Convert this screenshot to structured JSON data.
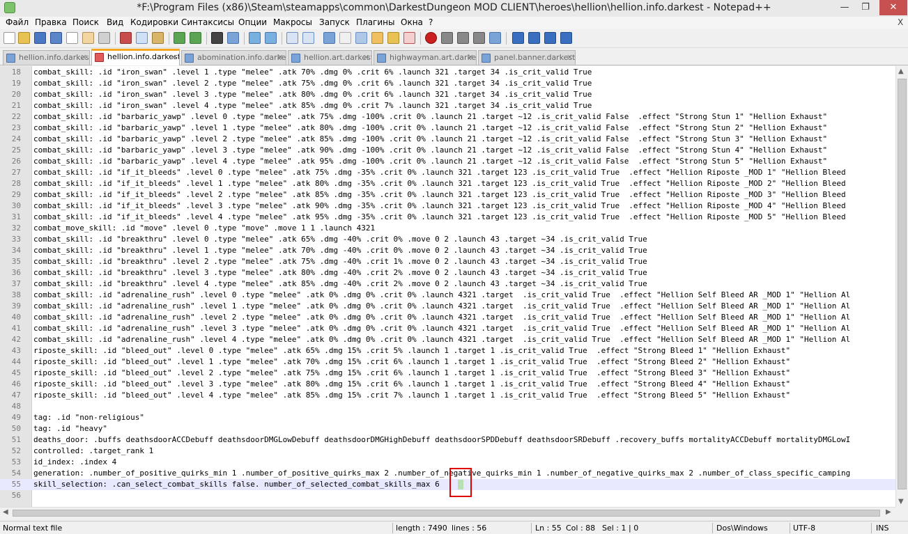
{
  "window": {
    "title": "*F:\\Program Files (x86)\\Steam\\steamapps\\common\\DarkestDungeon MOD CLIENT\\heroes\\hellion\\hellion.info.darkest - Notepad++",
    "minimize": "—",
    "maximize": "❐",
    "close": "✕"
  },
  "menu": {
    "items": [
      "Файл",
      "Правка",
      "Поиск",
      "Вид",
      "Кодировки",
      "Синтаксисы",
      "Опции",
      "Макросы",
      "Запуск",
      "Плагины",
      "Окна",
      "?"
    ],
    "close": "X"
  },
  "tabs": [
    {
      "label": "hellion.info.darkest",
      "active": false
    },
    {
      "label": "hellion.info.darkest",
      "active": true
    },
    {
      "label": "abomination.info.darkest",
      "active": false
    },
    {
      "label": "hellion.art.darkest",
      "active": false
    },
    {
      "label": "highwayman.art.darkest",
      "active": false
    },
    {
      "label": "panel.banner.darkest",
      "active": false
    }
  ],
  "editor": {
    "current_line": 55,
    "lines": [
      {
        "n": "18",
        "text": "combat_skill: .id \"iron_swan\" .level 1 .type \"melee\" .atk 70% .dmg 0% .crit 6% .launch 321 .target 34 .is_crit_valid True"
      },
      {
        "n": "19",
        "text": "combat_skill: .id \"iron_swan\" .level 2 .type \"melee\" .atk 75% .dmg 0% .crit 6% .launch 321 .target 34 .is_crit_valid True"
      },
      {
        "n": "20",
        "text": "combat_skill: .id \"iron_swan\" .level 3 .type \"melee\" .atk 80% .dmg 0% .crit 6% .launch 321 .target 34 .is_crit_valid True"
      },
      {
        "n": "21",
        "text": "combat_skill: .id \"iron_swan\" .level 4 .type \"melee\" .atk 85% .dmg 0% .crit 7% .launch 321 .target 34 .is_crit_valid True"
      },
      {
        "n": "22",
        "text": "combat_skill: .id \"barbaric_yawp\" .level 0 .type \"melee\" .atk 75% .dmg -100% .crit 0% .launch 21 .target ~12 .is_crit_valid False  .effect \"Strong Stun 1\" \"Hellion Exhaust\""
      },
      {
        "n": "23",
        "text": "combat_skill: .id \"barbaric_yawp\" .level 1 .type \"melee\" .atk 80% .dmg -100% .crit 0% .launch 21 .target ~12 .is_crit_valid False  .effect \"Strong Stun 2\" \"Hellion Exhaust\""
      },
      {
        "n": "24",
        "text": "combat_skill: .id \"barbaric_yawp\" .level 2 .type \"melee\" .atk 85% .dmg -100% .crit 0% .launch 21 .target ~12 .is_crit_valid False  .effect \"Strong Stun 3\" \"Hellion Exhaust\""
      },
      {
        "n": "25",
        "text": "combat_skill: .id \"barbaric_yawp\" .level 3 .type \"melee\" .atk 90% .dmg -100% .crit 0% .launch 21 .target ~12 .is_crit_valid False  .effect \"Strong Stun 4\" \"Hellion Exhaust\""
      },
      {
        "n": "26",
        "text": "combat_skill: .id \"barbaric_yawp\" .level 4 .type \"melee\" .atk 95% .dmg -100% .crit 0% .launch 21 .target ~12 .is_crit_valid False  .effect \"Strong Stun 5\" \"Hellion Exhaust\""
      },
      {
        "n": "27",
        "text": "combat_skill: .id \"if_it_bleeds\" .level 0 .type \"melee\" .atk 75% .dmg -35% .crit 0% .launch 321 .target 123 .is_crit_valid True  .effect \"Hellion Riposte _MOD 1\" \"Hellion Bleed"
      },
      {
        "n": "28",
        "text": "combat_skill: .id \"if_it_bleeds\" .level 1 .type \"melee\" .atk 80% .dmg -35% .crit 0% .launch 321 .target 123 .is_crit_valid True  .effect \"Hellion Riposte _MOD 2\" \"Hellion Bleed"
      },
      {
        "n": "29",
        "text": "combat_skill: .id \"if_it_bleeds\" .level 2 .type \"melee\" .atk 85% .dmg -35% .crit 0% .launch 321 .target 123 .is_crit_valid True  .effect \"Hellion Riposte _MOD 3\" \"Hellion Bleed"
      },
      {
        "n": "30",
        "text": "combat_skill: .id \"if_it_bleeds\" .level 3 .type \"melee\" .atk 90% .dmg -35% .crit 0% .launch 321 .target 123 .is_crit_valid True  .effect \"Hellion Riposte _MOD 4\" \"Hellion Bleed"
      },
      {
        "n": "31",
        "text": "combat_skill: .id \"if_it_bleeds\" .level 4 .type \"melee\" .atk 95% .dmg -35% .crit 0% .launch 321 .target 123 .is_crit_valid True  .effect \"Hellion Riposte _MOD 5\" \"Hellion Bleed"
      },
      {
        "n": "32",
        "text": "combat_move_skill: .id \"move\" .level 0 .type \"move\" .move 1 1 .launch 4321"
      },
      {
        "n": "33",
        "text": "combat_skill: .id \"breakthru\" .level 0 .type \"melee\" .atk 65% .dmg -40% .crit 0% .move 0 2 .launch 43 .target ~34 .is_crit_valid True"
      },
      {
        "n": "34",
        "text": "combat_skill: .id \"breakthru\" .level 1 .type \"melee\" .atk 70% .dmg -40% .crit 0% .move 0 2 .launch 43 .target ~34 .is_crit_valid True"
      },
      {
        "n": "35",
        "text": "combat_skill: .id \"breakthru\" .level 2 .type \"melee\" .atk 75% .dmg -40% .crit 1% .move 0 2 .launch 43 .target ~34 .is_crit_valid True"
      },
      {
        "n": "36",
        "text": "combat_skill: .id \"breakthru\" .level 3 .type \"melee\" .atk 80% .dmg -40% .crit 2% .move 0 2 .launch 43 .target ~34 .is_crit_valid True"
      },
      {
        "n": "37",
        "text": "combat_skill: .id \"breakthru\" .level 4 .type \"melee\" .atk 85% .dmg -40% .crit 2% .move 0 2 .launch 43 .target ~34 .is_crit_valid True"
      },
      {
        "n": "38",
        "text": "combat_skill: .id \"adrenaline_rush\" .level 0 .type \"melee\" .atk 0% .dmg 0% .crit 0% .launch 4321 .target  .is_crit_valid True  .effect \"Hellion Self Bleed AR _MOD 1\" \"Hellion Al"
      },
      {
        "n": "39",
        "text": "combat_skill: .id \"adrenaline_rush\" .level 1 .type \"melee\" .atk 0% .dmg 0% .crit 0% .launch 4321 .target  .is_crit_valid True  .effect \"Hellion Self Bleed AR _MOD 1\" \"Hellion Al"
      },
      {
        "n": "40",
        "text": "combat_skill: .id \"adrenaline_rush\" .level 2 .type \"melee\" .atk 0% .dmg 0% .crit 0% .launch 4321 .target  .is_crit_valid True  .effect \"Hellion Self Bleed AR _MOD 1\" \"Hellion Al"
      },
      {
        "n": "41",
        "text": "combat_skill: .id \"adrenaline_rush\" .level 3 .type \"melee\" .atk 0% .dmg 0% .crit 0% .launch 4321 .target  .is_crit_valid True  .effect \"Hellion Self Bleed AR _MOD 1\" \"Hellion Al"
      },
      {
        "n": "42",
        "text": "combat_skill: .id \"adrenaline_rush\" .level 4 .type \"melee\" .atk 0% .dmg 0% .crit 0% .launch 4321 .target  .is_crit_valid True  .effect \"Hellion Self Bleed AR _MOD 1\" \"Hellion Al"
      },
      {
        "n": "43",
        "text": "riposte_skill: .id \"bleed_out\" .level 0 .type \"melee\" .atk 65% .dmg 15% .crit 5% .launch 1 .target 1 .is_crit_valid True  .effect \"Strong Bleed 1\" \"Hellion Exhaust\""
      },
      {
        "n": "44",
        "text": "riposte_skill: .id \"bleed_out\" .level 1 .type \"melee\" .atk 70% .dmg 15% .crit 6% .launch 1 .target 1 .is_crit_valid True  .effect \"Strong Bleed 2\" \"Hellion Exhaust\""
      },
      {
        "n": "45",
        "text": "riposte_skill: .id \"bleed_out\" .level 2 .type \"melee\" .atk 75% .dmg 15% .crit 6% .launch 1 .target 1 .is_crit_valid True  .effect \"Strong Bleed 3\" \"Hellion Exhaust\""
      },
      {
        "n": "46",
        "text": "riposte_skill: .id \"bleed_out\" .level 3 .type \"melee\" .atk 80% .dmg 15% .crit 6% .launch 1 .target 1 .is_crit_valid True  .effect \"Strong Bleed 4\" \"Hellion Exhaust\""
      },
      {
        "n": "47",
        "text": "riposte_skill: .id \"bleed_out\" .level 4 .type \"melee\" .atk 85% .dmg 15% .crit 7% .launch 1 .target 1 .is_crit_valid True  .effect \"Strong Bleed 5\" \"Hellion Exhaust\""
      },
      {
        "n": "48",
        "text": ""
      },
      {
        "n": "49",
        "text": "tag: .id \"non-religious\""
      },
      {
        "n": "50",
        "text": "tag: .id \"heavy\""
      },
      {
        "n": "51",
        "text": "deaths_door: .buffs deathsdoorACCDebuff deathsdoorDMGLowDebuff deathsdoorDMGHighDebuff deathsdoorSPDDebuff deathsdoorSRDebuff .recovery_buffs mortalityACCDebuff mortalityDMGLowI"
      },
      {
        "n": "52",
        "text": "controlled: .target_rank 1"
      },
      {
        "n": "53",
        "text": "id_index: .index 4"
      },
      {
        "n": "54",
        "text": "generation: .number_of_positive_quirks_min 1 .number_of_positive_quirks_max 2 .number_of_negative_quirks_min 1 .number_of_negative_quirks_max 2 .number_of_class_specific_camping"
      },
      {
        "n": "55",
        "text": "skill_selection: .can_select_combat_skills false. number_of_selected_combat_skills_max 6"
      },
      {
        "n": "56",
        "text": ""
      }
    ]
  },
  "status": {
    "file_type": "Normal text file",
    "length": "length : 7490",
    "lines": "lines : 56",
    "ln": "Ln : 55",
    "col": "Col : 88",
    "sel": "Sel : 1 | 0",
    "eol": "Dos\\Windows",
    "encoding": "UTF-8",
    "mode": "INS"
  },
  "scroll": {
    "up": "▲",
    "down": "▼",
    "left": "◀",
    "right": "▶"
  },
  "colors": {
    "active_tab_accent": "#f5a623",
    "current_line": "#e8e8ff",
    "gutter": "#e4e4e4",
    "highlight_box": "#e00000"
  }
}
